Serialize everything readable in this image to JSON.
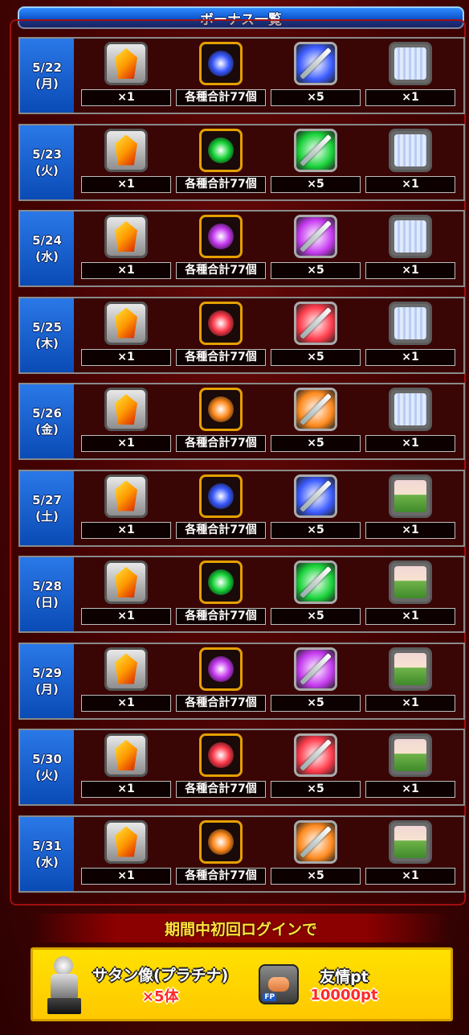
{
  "header": {
    "title": "ボーナス一覧"
  },
  "labels": {
    "qty_stone": "×1",
    "qty_orb": "各種合計77個",
    "qty_sword": "×5",
    "qty_frame": "×1"
  },
  "days": [
    {
      "date": "5/22",
      "weekday": "(月)",
      "orb_color": "blue",
      "frame": "curtain"
    },
    {
      "date": "5/23",
      "weekday": "(火)",
      "orb_color": "green",
      "frame": "curtain"
    },
    {
      "date": "5/24",
      "weekday": "(水)",
      "orb_color": "purple",
      "frame": "curtain"
    },
    {
      "date": "5/25",
      "weekday": "(木)",
      "orb_color": "red",
      "frame": "curtain"
    },
    {
      "date": "5/26",
      "weekday": "(金)",
      "orb_color": "orange",
      "frame": "curtain"
    },
    {
      "date": "5/27",
      "weekday": "(土)",
      "orb_color": "blue",
      "frame": "scene"
    },
    {
      "date": "5/28",
      "weekday": "(日)",
      "orb_color": "green",
      "frame": "scene"
    },
    {
      "date": "5/29",
      "weekday": "(月)",
      "orb_color": "purple",
      "frame": "scene"
    },
    {
      "date": "5/30",
      "weekday": "(火)",
      "orb_color": "red",
      "frame": "scene"
    },
    {
      "date": "5/31",
      "weekday": "(水)",
      "orb_color": "orange",
      "frame": "scene"
    }
  ],
  "colors": {
    "blue": "#3b5bff",
    "green": "#19d43a",
    "purple": "#c63bf0",
    "red": "#ff3b4b",
    "orange": "#ff8a1e"
  },
  "first_login": {
    "banner": "期間中初回ログインで",
    "reward1_name": "サタン像(プラチナ)",
    "reward1_qty": "×5体",
    "reward2_name": "友情pt",
    "reward2_qty": "10000pt",
    "fp_badge": "FP"
  }
}
